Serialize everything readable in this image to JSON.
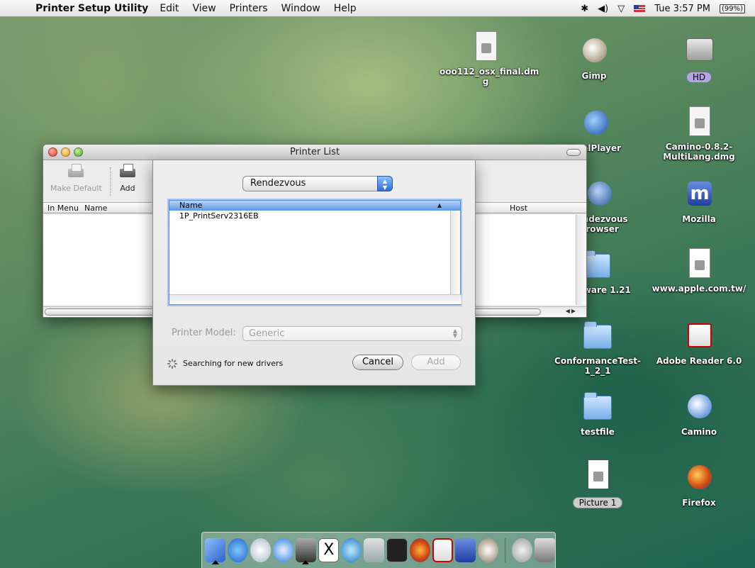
{
  "menubar": {
    "app_name": "Printer Setup Utility",
    "menus": [
      "Edit",
      "View",
      "Printers",
      "Window",
      "Help"
    ],
    "clock": "Tue 3:57 PM",
    "battery": "(99%)"
  },
  "desktop_icons": [
    {
      "label": "ooo112_osx_final.dm g",
      "icon": "disk-image-icon"
    },
    {
      "label": "Gimp",
      "icon": "gimp-icon"
    },
    {
      "label": "HD",
      "icon": "hard-disk-icon"
    },
    {
      "label": "RealPlayer",
      "icon": "realplayer-icon"
    },
    {
      "label": "Camino-0.8.2-MultiLang.dmg",
      "icon": "disk-image-icon"
    },
    {
      "label": "Rendezvous Browser",
      "icon": "rendezvous-browser-icon"
    },
    {
      "label": "Mozilla",
      "icon": "mozilla-icon"
    },
    {
      "label": "Firmware 1.21",
      "icon": "folder-icon"
    },
    {
      "label": "www.apple.com.tw/",
      "icon": "web-location-icon"
    },
    {
      "label": "ConformanceTest-1_2_1",
      "icon": "folder-icon"
    },
    {
      "label": "Adobe Reader 6.0",
      "icon": "adobe-reader-icon"
    },
    {
      "label": "testfile",
      "icon": "folder-icon"
    },
    {
      "label": "Camino",
      "icon": "camino-icon"
    },
    {
      "label": "Picture 1",
      "icon": "pdf-icon"
    },
    {
      "label": "Firefox",
      "icon": "firefox-icon"
    }
  ],
  "printer_list": {
    "title": "Printer List",
    "toolbar": {
      "make_default": "Make Default",
      "add": "Add"
    },
    "columns": {
      "in_menu": "In Menu",
      "name": "Name",
      "host": "Host"
    }
  },
  "sheet": {
    "connection": "Rendezvous",
    "table_header": "Name",
    "printers": [
      "1P_PrintServ2316EB"
    ],
    "model_label": "Printer Model:",
    "model_value": "Generic",
    "status": "Searching for new drivers",
    "cancel": "Cancel",
    "add": "Add"
  },
  "dock_items": [
    "finder-icon",
    "internet-explorer-icon",
    "mail-icon",
    "safari-icon",
    "printer-setup-icon",
    "x11-icon",
    "quicktime-icon",
    "iphoto-icon",
    "terminal-icon",
    "firefox-icon",
    "adobe-reader-icon",
    "mozilla-icon",
    "gimp-icon",
    "url-icon",
    "trash-icon"
  ],
  "colors": {
    "accent": "#2c6fd8",
    "selection": "#5d98e6"
  }
}
